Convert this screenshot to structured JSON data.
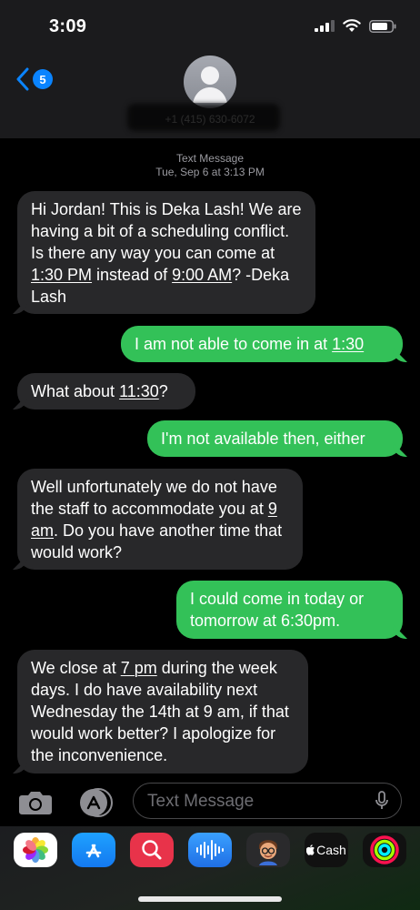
{
  "status": {
    "time": "3:09"
  },
  "header": {
    "back_count": "5",
    "contact": "+1 (415) 630-6072"
  },
  "meta": {
    "label": "Text Message",
    "timestamp": "Tue, Sep 6 at 3:13 PM"
  },
  "messages": [
    {
      "from": "them",
      "parts": [
        "Hi Jordan! This is Deka Lash! We are having a bit of a scheduling conflict. Is there any way you can come at ",
        "1:30 PM",
        " instead of ",
        "9:00 AM",
        "? -Deka Lash"
      ]
    },
    {
      "from": "me",
      "parts": [
        "I am not able to come in at ",
        "1:30"
      ]
    },
    {
      "from": "them",
      "parts": [
        "What about ",
        "11:30",
        "?"
      ]
    },
    {
      "from": "me",
      "parts": [
        "I'm not available then, either"
      ]
    },
    {
      "from": "them",
      "parts": [
        "Well unfortunately we do not have the staff to accommodate you at ",
        "9 am",
        ". Do you have another time that would work?"
      ]
    },
    {
      "from": "me",
      "parts": [
        "I could come in today or tomorrow at 6:30pm."
      ]
    },
    {
      "from": "them",
      "parts": [
        "We close at ",
        "7 pm",
        " during the week days. I do have availability next Wednesday the 14th at 9 am, if that would work better? I apologize for the inconvenience."
      ]
    }
  ],
  "input": {
    "placeholder": "Text Message"
  },
  "apps": [
    {
      "name": "Photos",
      "icon": "photos-icon"
    },
    {
      "name": "App Store",
      "icon": "app-store-icon"
    },
    {
      "name": "Search Images",
      "icon": "image-search-icon"
    },
    {
      "name": "Audio Message",
      "icon": "audio-waveform-icon"
    },
    {
      "name": "Memoji",
      "icon": "memoji-icon"
    },
    {
      "name": "Cash",
      "label": "Cash",
      "icon": "apple-cash-icon"
    },
    {
      "name": "Fitness",
      "icon": "activity-rings-icon"
    }
  ],
  "colors": {
    "incoming": "#28282a",
    "outgoing": "#33c158",
    "accent": "#0a84ff"
  }
}
